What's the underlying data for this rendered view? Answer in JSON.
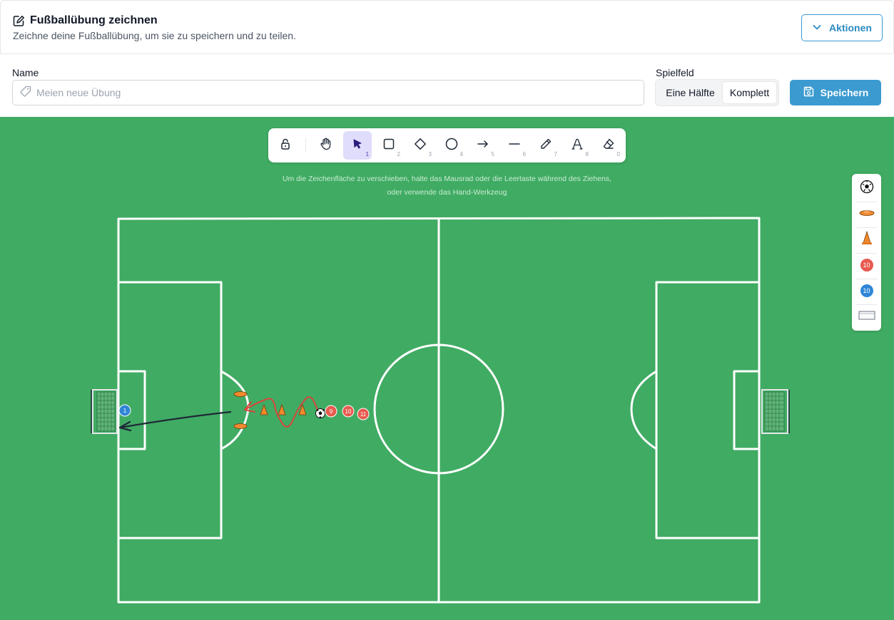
{
  "header": {
    "title": "Fußballübung zeichnen",
    "subtitle": "Zeichne deine Fußballübung, um sie zu speichern und zu teilen.",
    "actions_label": "Aktionen",
    "edit_icon": "edit-icon",
    "chevron_icon": "chevron-down-icon"
  },
  "form": {
    "name_label": "Name",
    "name_placeholder": "Meien neue Übung",
    "name_value": "",
    "field_label": "Spielfeld",
    "field_options": [
      "Eine Hälfte",
      "Komplett"
    ],
    "field_selected": "Komplett",
    "save_label": "Speichern",
    "tag_icon": "tag-icon",
    "save_icon": "floppy-disk-icon"
  },
  "toolbar": {
    "tools": [
      {
        "icon": "lock-icon",
        "num": ""
      },
      {
        "icon": "hand-icon",
        "num": ""
      },
      {
        "icon": "cursor-icon",
        "num": "1"
      },
      {
        "icon": "rectangle-icon",
        "num": "2"
      },
      {
        "icon": "diamond-icon",
        "num": "3"
      },
      {
        "icon": "circle-icon",
        "num": "4"
      },
      {
        "icon": "arrow-icon",
        "num": "5"
      },
      {
        "icon": "line-icon",
        "num": "6"
      },
      {
        "icon": "pencil-icon",
        "num": "7"
      },
      {
        "icon": "text-icon",
        "num": "8"
      },
      {
        "icon": "eraser-icon",
        "num": "0"
      }
    ],
    "active_tool": "cursor-icon"
  },
  "hint": {
    "line1": "Um die Zeichenfläche zu verschieben, halte das Mausrad oder die Leertaste während des Ziehens,",
    "line2": "oder verwende das Hand-Werkzeug"
  },
  "palette": {
    "items": [
      {
        "icon": "soccer-ball-icon",
        "label": ""
      },
      {
        "icon": "marker-disc-icon",
        "label": ""
      },
      {
        "icon": "cone-icon",
        "label": ""
      },
      {
        "icon": "red-player-icon",
        "label": "10"
      },
      {
        "icon": "blue-player-icon",
        "label": "10"
      },
      {
        "icon": "goal-icon",
        "label": ""
      }
    ]
  },
  "drill": {
    "red_players": [
      "9",
      "10",
      "11"
    ],
    "blue_players": [
      "1"
    ]
  },
  "colors": {
    "pitch": "#40ab63",
    "accent": "#3b9ad0",
    "red_player": "#e85a4f",
    "blue_player": "#2f86d6",
    "cone": "#f08a2c"
  }
}
